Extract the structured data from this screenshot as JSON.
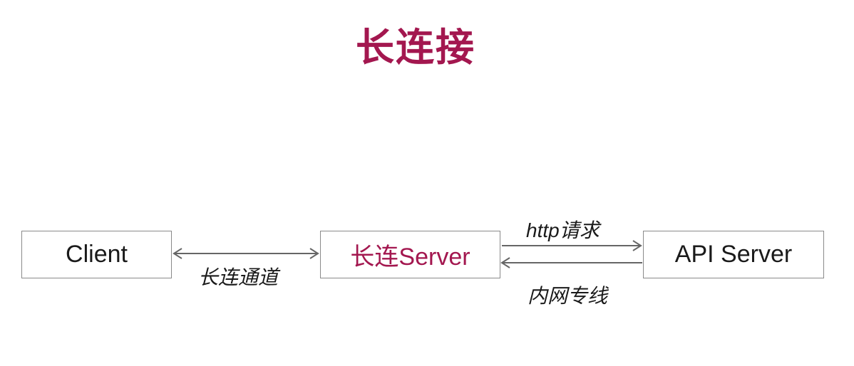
{
  "title": "长连接",
  "nodes": {
    "client": "Client",
    "long_server": "长连Server",
    "api_server": "API Server"
  },
  "edges": {
    "channel": "长连通道",
    "http_request": "http请求",
    "private_line": "内网专线"
  },
  "colors": {
    "accent": "#a3174f",
    "border": "#8a8a8a",
    "arrow": "#666666",
    "text": "#1a1a1a"
  }
}
